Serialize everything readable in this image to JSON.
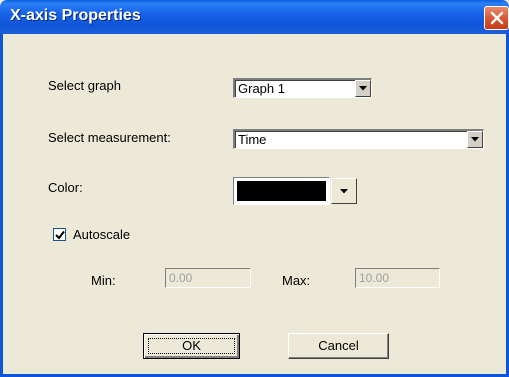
{
  "window": {
    "title": "X-axis Properties"
  },
  "form": {
    "select_graph": {
      "label": "Select graph",
      "value": "Graph 1"
    },
    "select_measurement": {
      "label": "Select measurement:",
      "value": "Time"
    },
    "color": {
      "label": "Color:",
      "value": "#000000"
    },
    "autoscale": {
      "label": "Autoscale",
      "checked": true
    },
    "min": {
      "label": "Min:",
      "value": "0.00",
      "disabled": true
    },
    "max": {
      "label": "Max:",
      "value": "10.00",
      "disabled": true
    }
  },
  "buttons": {
    "ok": "OK",
    "cancel": "Cancel"
  },
  "icons": {
    "close": "close-icon",
    "dropdown": "chevron-down-icon",
    "check": "check-icon"
  },
  "colors": {
    "titlebar": "#0f55d8",
    "close": "#d5512c",
    "dialog_bg": "#ece9d8"
  }
}
